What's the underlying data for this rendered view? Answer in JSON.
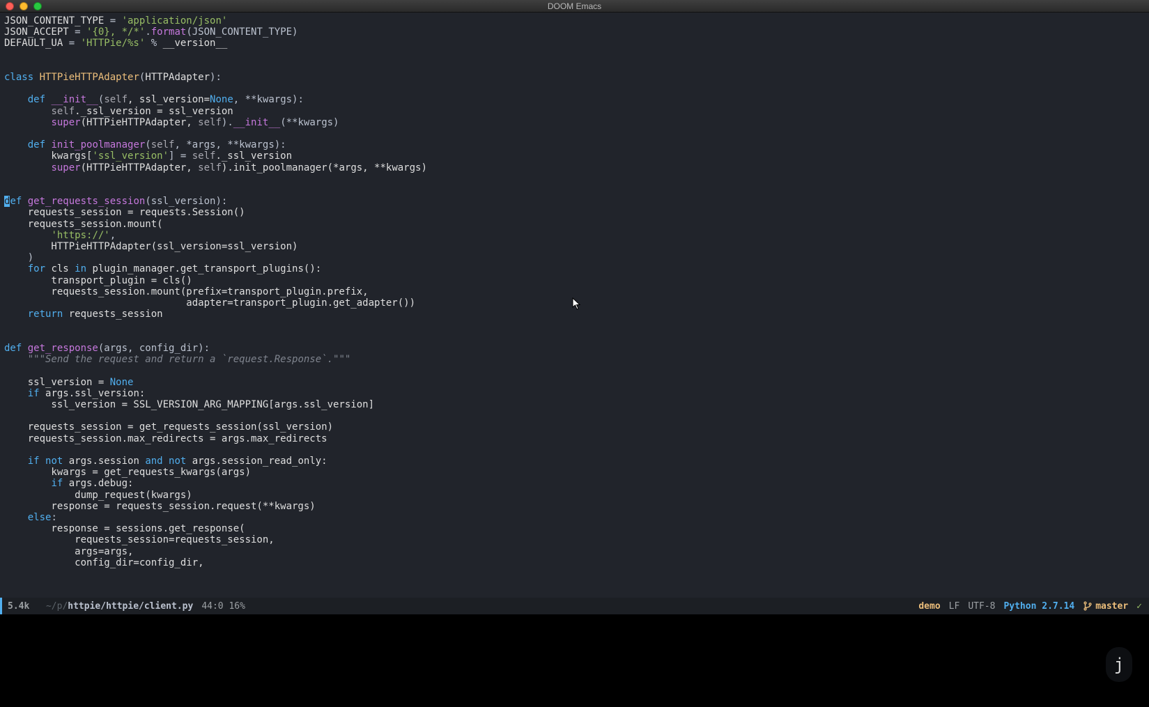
{
  "window": {
    "title": "DOOM Emacs"
  },
  "code": {
    "lines": [
      [
        {
          "t": "JSON_CONTENT_TYPE ",
          "c": "const"
        },
        {
          "t": "= ",
          "c": "op"
        },
        {
          "t": "'application/json'",
          "c": "str"
        }
      ],
      [
        {
          "t": "JSON_ACCEPT ",
          "c": "const"
        },
        {
          "t": "= ",
          "c": "op"
        },
        {
          "t": "'{0}, */*'",
          "c": "str"
        },
        {
          "t": ".",
          "c": "punct"
        },
        {
          "t": "format",
          "c": "builtin"
        },
        {
          "t": "(JSON_CONTENT_TYPE)",
          "c": "punct"
        }
      ],
      [
        {
          "t": "DEFAULT_UA ",
          "c": "const"
        },
        {
          "t": "= ",
          "c": "op"
        },
        {
          "t": "'HTTPie/%s'",
          "c": "str"
        },
        {
          "t": " % ",
          "c": "op"
        },
        {
          "t": "__version__",
          "c": "var"
        }
      ],
      [],
      [],
      [
        {
          "t": "class ",
          "c": "kw"
        },
        {
          "t": "HTTPieHTTPAdapter",
          "c": "cls"
        },
        {
          "t": "(",
          "c": "punct"
        },
        {
          "t": "HTTPAdapter",
          "c": "var"
        },
        {
          "t": "):",
          "c": "punct"
        }
      ],
      [],
      [
        {
          "t": "    ",
          "c": ""
        },
        {
          "t": "def ",
          "c": "kw"
        },
        {
          "t": "__init__",
          "c": "fn"
        },
        {
          "t": "(",
          "c": "punct"
        },
        {
          "t": "self",
          "c": "self"
        },
        {
          "t": ", ssl_version=",
          "c": "var"
        },
        {
          "t": "None",
          "c": "kw"
        },
        {
          "t": ", **kwargs):",
          "c": "punct"
        }
      ],
      [
        {
          "t": "        ",
          "c": ""
        },
        {
          "t": "self",
          "c": "self"
        },
        {
          "t": "._ssl_version = ssl_version",
          "c": "var"
        }
      ],
      [
        {
          "t": "        ",
          "c": ""
        },
        {
          "t": "super",
          "c": "builtin"
        },
        {
          "t": "(HTTPieHTTPAdapter, ",
          "c": "var"
        },
        {
          "t": "self",
          "c": "self"
        },
        {
          "t": ").",
          "c": "punct"
        },
        {
          "t": "__init__",
          "c": "fn"
        },
        {
          "t": "(**kwargs)",
          "c": "punct"
        }
      ],
      [],
      [
        {
          "t": "    ",
          "c": ""
        },
        {
          "t": "def ",
          "c": "kw"
        },
        {
          "t": "init_poolmanager",
          "c": "fn"
        },
        {
          "t": "(",
          "c": "punct"
        },
        {
          "t": "self",
          "c": "self"
        },
        {
          "t": ", *args, **kwargs):",
          "c": "punct"
        }
      ],
      [
        {
          "t": "        kwargs[",
          "c": "var"
        },
        {
          "t": "'ssl_version'",
          "c": "str"
        },
        {
          "t": "] = ",
          "c": "op"
        },
        {
          "t": "self",
          "c": "self"
        },
        {
          "t": "._ssl_version",
          "c": "var"
        }
      ],
      [
        {
          "t": "        ",
          "c": ""
        },
        {
          "t": "super",
          "c": "builtin"
        },
        {
          "t": "(HTTPieHTTPAdapter, ",
          "c": "var"
        },
        {
          "t": "self",
          "c": "self"
        },
        {
          "t": ").init_poolmanager(*args, **kwargs)",
          "c": "var"
        }
      ],
      [],
      [],
      [
        {
          "t": "d",
          "c": "cursor-bg"
        },
        {
          "t": "ef ",
          "c": "kw"
        },
        {
          "t": "get_requests_session",
          "c": "fn"
        },
        {
          "t": "(ssl_version):",
          "c": "punct"
        }
      ],
      [
        {
          "t": "    requests_session = requests.Session()",
          "c": "var"
        }
      ],
      [
        {
          "t": "    requests_session.mount(",
          "c": "var"
        }
      ],
      [
        {
          "t": "        ",
          "c": ""
        },
        {
          "t": "'https://'",
          "c": "str"
        },
        {
          "t": ",",
          "c": "punct"
        }
      ],
      [
        {
          "t": "        HTTPieHTTPAdapter(ssl_version=ssl_version)",
          "c": "var"
        }
      ],
      [
        {
          "t": "    )",
          "c": "punct"
        }
      ],
      [
        {
          "t": "    ",
          "c": ""
        },
        {
          "t": "for ",
          "c": "kw"
        },
        {
          "t": "cls ",
          "c": "var"
        },
        {
          "t": "in ",
          "c": "kw"
        },
        {
          "t": "plugin_manager.get_transport_plugins():",
          "c": "var"
        }
      ],
      [
        {
          "t": "        transport_plugin = cls()",
          "c": "var"
        }
      ],
      [
        {
          "t": "        requests_session.mount(prefix=transport_plugin.prefix,",
          "c": "var"
        }
      ],
      [
        {
          "t": "                               adapter=transport_plugin.get_adapter())",
          "c": "var"
        }
      ],
      [
        {
          "t": "    ",
          "c": ""
        },
        {
          "t": "return ",
          "c": "kw"
        },
        {
          "t": "requests_session",
          "c": "var"
        }
      ],
      [],
      [],
      [
        {
          "t": "def ",
          "c": "kw"
        },
        {
          "t": "get_response",
          "c": "fn"
        },
        {
          "t": "(args, config_dir):",
          "c": "punct"
        }
      ],
      [
        {
          "t": "    ",
          "c": ""
        },
        {
          "t": "\"\"\"Send the request and return a `request.Response`.\"\"\"",
          "c": "doc"
        }
      ],
      [],
      [
        {
          "t": "    ssl_version = ",
          "c": "var"
        },
        {
          "t": "None",
          "c": "kw"
        }
      ],
      [
        {
          "t": "    ",
          "c": ""
        },
        {
          "t": "if ",
          "c": "kw"
        },
        {
          "t": "args.ssl_version:",
          "c": "var"
        }
      ],
      [
        {
          "t": "        ssl_version = SSL_VERSION_ARG_MAPPING[args.ssl_version]",
          "c": "var"
        }
      ],
      [],
      [
        {
          "t": "    requests_session = get_requests_session(ssl_version)",
          "c": "var"
        }
      ],
      [
        {
          "t": "    requests_session.max_redirects = args.max_redirects",
          "c": "var"
        }
      ],
      [],
      [
        {
          "t": "    ",
          "c": ""
        },
        {
          "t": "if ",
          "c": "kw"
        },
        {
          "t": "not ",
          "c": "kw"
        },
        {
          "t": "args.session ",
          "c": "var"
        },
        {
          "t": "and ",
          "c": "kw"
        },
        {
          "t": "not ",
          "c": "kw"
        },
        {
          "t": "args.session_read_only:",
          "c": "var"
        }
      ],
      [
        {
          "t": "        kwargs = get_requests_kwargs(args)",
          "c": "var"
        }
      ],
      [
        {
          "t": "        ",
          "c": ""
        },
        {
          "t": "if ",
          "c": "kw"
        },
        {
          "t": "args.debug:",
          "c": "var"
        }
      ],
      [
        {
          "t": "            dump_request(kwargs)",
          "c": "var"
        }
      ],
      [
        {
          "t": "        response = requests_session.request(**kwargs)",
          "c": "var"
        }
      ],
      [
        {
          "t": "    ",
          "c": ""
        },
        {
          "t": "else",
          "c": "kw"
        },
        {
          "t": ":",
          "c": "punct"
        }
      ],
      [
        {
          "t": "        response = sessions.get_response(",
          "c": "var"
        }
      ],
      [
        {
          "t": "            requests_session=requests_session,",
          "c": "var"
        }
      ],
      [
        {
          "t": "            args=args,",
          "c": "var"
        }
      ],
      [
        {
          "t": "            config_dir=config_dir,",
          "c": "var"
        }
      ]
    ]
  },
  "modeline": {
    "size": "5.4k",
    "path_prefix": "~/p/",
    "path_bold1": "httpie/httpie/",
    "path_bold2": "client.py",
    "position": "44:0 16%",
    "demo": "demo",
    "lf": "LF",
    "encoding": "UTF-8",
    "python": "Python 2.7.14",
    "branch": "master"
  },
  "key_indicator": "j"
}
